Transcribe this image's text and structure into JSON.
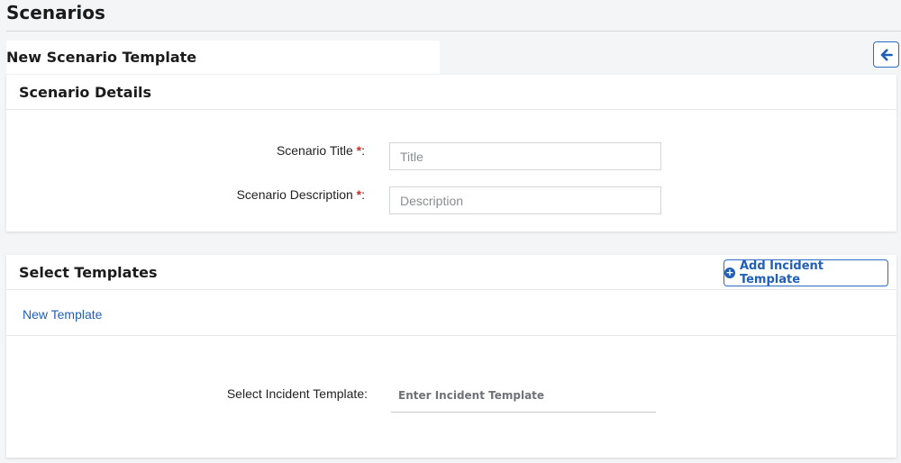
{
  "page": {
    "title": "Scenarios"
  },
  "subheader": {
    "title": "New Scenario Template"
  },
  "back_button": {
    "icon": "arrow-left-icon",
    "color": "#2a6cc4"
  },
  "scenario_details": {
    "title": "Scenario Details",
    "fields": [
      {
        "label": "Scenario Title",
        "required_mark": "*",
        "suffix": ":",
        "value": "",
        "placeholder": "Title"
      },
      {
        "label": "Scenario Description",
        "required_mark": "*",
        "suffix": ":",
        "value": "",
        "placeholder": "Description"
      }
    ]
  },
  "select_templates": {
    "title": "Select Templates",
    "add_button": {
      "icon": "plus-circle-icon",
      "label": "Add Incident Template"
    },
    "tabs": [
      {
        "label": "New Template"
      }
    ],
    "incident_field": {
      "label": "Select Incident Template:",
      "value": "",
      "placeholder": "Enter Incident Template"
    }
  },
  "colors": {
    "accent": "#1f5fb8",
    "required": "#d62828",
    "background": "#f4f5f7"
  }
}
